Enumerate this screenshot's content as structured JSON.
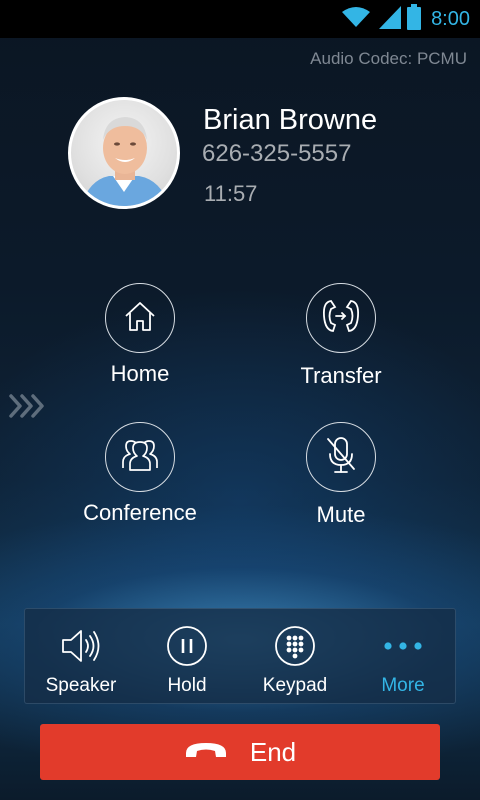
{
  "status_bar": {
    "time": "8:00",
    "icons": [
      "wifi-icon",
      "signal-icon",
      "battery-icon"
    ],
    "accent_color": "#33b5e5"
  },
  "call": {
    "codec": "Audio Codec: PCMU",
    "contact_name": "Brian Browne",
    "contact_number": "626-325-5557",
    "duration": "11:57"
  },
  "actions": {
    "home": {
      "label": "Home",
      "icon": "home-icon"
    },
    "transfer": {
      "label": "Transfer",
      "icon": "transfer-icon"
    },
    "conference": {
      "label": "Conference",
      "icon": "conference-icon"
    },
    "mute": {
      "label": "Mute",
      "icon": "mic-off-icon"
    }
  },
  "bottom_bar": {
    "speaker": {
      "label": "Speaker",
      "icon": "speaker-icon"
    },
    "hold": {
      "label": "Hold",
      "icon": "pause-icon"
    },
    "keypad": {
      "label": "Keypad",
      "icon": "keypad-icon"
    },
    "more": {
      "label": "More",
      "icon": "more-dots-icon",
      "color": "#33b5e5"
    }
  },
  "end_call": {
    "label": "End",
    "icon": "hangup-icon",
    "color": "#e23b2b"
  }
}
